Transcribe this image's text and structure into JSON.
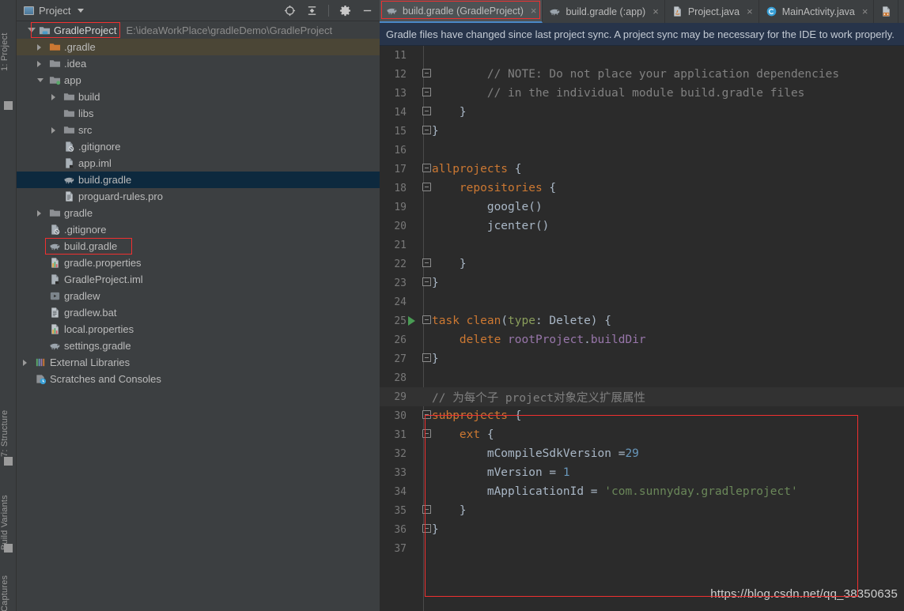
{
  "left_strip": {
    "top_label": "1: Project",
    "bottom_labels": [
      "7: Structure",
      "Build Variants",
      "Captures"
    ]
  },
  "project_panel": {
    "title": "Project",
    "toolbar_icons": [
      "locate-target-icon",
      "collapse-all-icon",
      "gear-icon",
      "minimize-icon"
    ],
    "root": {
      "name": "GradleProject",
      "path": "E:\\ideaWorkPlace\\gradleDemo\\GradleProject"
    },
    "tree": [
      {
        "label": ".gradle",
        "indent": 1,
        "arrow": "right",
        "icon": "folder-orange-icon",
        "state": "highlight"
      },
      {
        "label": ".idea",
        "indent": 1,
        "arrow": "right",
        "icon": "folder-icon",
        "state": ""
      },
      {
        "label": "app",
        "indent": 1,
        "arrow": "down",
        "icon": "module-folder-icon",
        "state": ""
      },
      {
        "label": "build",
        "indent": 2,
        "arrow": "right",
        "icon": "folder-icon",
        "state": ""
      },
      {
        "label": "libs",
        "indent": 2,
        "arrow": "none",
        "icon": "folder-icon",
        "state": ""
      },
      {
        "label": "src",
        "indent": 2,
        "arrow": "right",
        "icon": "folder-icon",
        "state": ""
      },
      {
        "label": ".gitignore",
        "indent": 2,
        "arrow": "none",
        "icon": "gitignore-file-icon",
        "state": ""
      },
      {
        "label": "app.iml",
        "indent": 2,
        "arrow": "none",
        "icon": "iml-file-icon",
        "state": ""
      },
      {
        "label": "build.gradle",
        "indent": 2,
        "arrow": "none",
        "icon": "gradle-file-icon",
        "state": "selected"
      },
      {
        "label": "proguard-rules.pro",
        "indent": 2,
        "arrow": "none",
        "icon": "text-file-icon",
        "state": ""
      },
      {
        "label": "gradle",
        "indent": 1,
        "arrow": "right",
        "icon": "folder-icon",
        "state": ""
      },
      {
        "label": ".gitignore",
        "indent": 1,
        "arrow": "none",
        "icon": "gitignore-file-icon",
        "state": ""
      },
      {
        "label": "build.gradle",
        "indent": 1,
        "arrow": "none",
        "icon": "gradle-file-icon",
        "state": "boxed"
      },
      {
        "label": "gradle.properties",
        "indent": 1,
        "arrow": "none",
        "icon": "properties-file-icon",
        "state": ""
      },
      {
        "label": "GradleProject.iml",
        "indent": 1,
        "arrow": "none",
        "icon": "iml-file-icon",
        "state": ""
      },
      {
        "label": "gradlew",
        "indent": 1,
        "arrow": "none",
        "icon": "script-file-icon",
        "state": ""
      },
      {
        "label": "gradlew.bat",
        "indent": 1,
        "arrow": "none",
        "icon": "text-file-icon",
        "state": ""
      },
      {
        "label": "local.properties",
        "indent": 1,
        "arrow": "none",
        "icon": "properties-file-icon",
        "state": ""
      },
      {
        "label": "settings.gradle",
        "indent": 1,
        "arrow": "none",
        "icon": "gradle-file-icon",
        "state": ""
      },
      {
        "label": "External Libraries",
        "indent": 0,
        "arrow": "right",
        "icon": "libraries-icon",
        "state": ""
      },
      {
        "label": "Scratches and Consoles",
        "indent": 0,
        "arrow": "none",
        "icon": "scratches-icon",
        "state": ""
      }
    ]
  },
  "editor": {
    "tabs": [
      {
        "label": "build.gradle (GradleProject)",
        "icon": "gradle-file-icon",
        "active": true,
        "closable": true,
        "boxed": true
      },
      {
        "label": "build.gradle (:app)",
        "icon": "gradle-file-icon",
        "active": false,
        "closable": true,
        "boxed": false
      },
      {
        "label": "Project.java",
        "icon": "java-file-icon",
        "active": false,
        "closable": true,
        "boxed": false
      },
      {
        "label": "MainActivity.java",
        "icon": "java-class-icon",
        "active": false,
        "closable": true,
        "boxed": false
      },
      {
        "label": "",
        "icon": "xml-file-icon",
        "active": false,
        "closable": false,
        "boxed": false
      }
    ],
    "notification": "Gradle files have changed since last project sync. A project sync may be necessary for the IDE to work properly.",
    "first_line_number": 11,
    "lines": [
      {
        "n": 11,
        "text": "",
        "fold": "",
        "caret": false,
        "run": false
      },
      {
        "n": 12,
        "text": "        // NOTE: Do not place your application dependencies",
        "fold": "start",
        "caret": false,
        "run": false
      },
      {
        "n": 13,
        "text": "        // in the individual module build.gradle files",
        "fold": "end",
        "caret": false,
        "run": false
      },
      {
        "n": 14,
        "text": "    }",
        "fold": "end",
        "caret": false,
        "run": false
      },
      {
        "n": 15,
        "text": "}",
        "fold": "end",
        "caret": false,
        "run": false
      },
      {
        "n": 16,
        "text": "",
        "fold": "",
        "caret": false,
        "run": false
      },
      {
        "n": 17,
        "text": "allprojects {",
        "fold": "start",
        "caret": false,
        "run": false
      },
      {
        "n": 18,
        "text": "    repositories {",
        "fold": "start",
        "caret": false,
        "run": false
      },
      {
        "n": 19,
        "text": "        google()",
        "fold": "",
        "caret": false,
        "run": false
      },
      {
        "n": 20,
        "text": "        jcenter()",
        "fold": "",
        "caret": false,
        "run": false
      },
      {
        "n": 21,
        "text": "",
        "fold": "",
        "caret": false,
        "run": false
      },
      {
        "n": 22,
        "text": "    }",
        "fold": "end",
        "caret": false,
        "run": false
      },
      {
        "n": 23,
        "text": "}",
        "fold": "end",
        "caret": false,
        "run": false
      },
      {
        "n": 24,
        "text": "",
        "fold": "",
        "caret": false,
        "run": false
      },
      {
        "n": 25,
        "text": "task clean(type: Delete) {",
        "fold": "start",
        "caret": false,
        "run": true
      },
      {
        "n": 26,
        "text": "    delete rootProject.buildDir",
        "fold": "",
        "caret": false,
        "run": false
      },
      {
        "n": 27,
        "text": "}",
        "fold": "end",
        "caret": false,
        "run": false
      },
      {
        "n": 28,
        "text": "",
        "fold": "",
        "caret": false,
        "run": false
      },
      {
        "n": 29,
        "text": "// 为每个子 project对象定义扩展属性",
        "fold": "",
        "caret": true,
        "run": false
      },
      {
        "n": 30,
        "text": "subprojects {",
        "fold": "start",
        "caret": false,
        "run": false
      },
      {
        "n": 31,
        "text": "    ext {",
        "fold": "start",
        "caret": false,
        "run": false
      },
      {
        "n": 32,
        "text": "        mCompileSdkVersion =29",
        "fold": "",
        "caret": false,
        "run": false
      },
      {
        "n": 33,
        "text": "        mVersion = 1",
        "fold": "",
        "caret": false,
        "run": false
      },
      {
        "n": 34,
        "text": "        mApplicationId = 'com.sunnyday.gradleproject'",
        "fold": "",
        "caret": false,
        "run": false
      },
      {
        "n": 35,
        "text": "    }",
        "fold": "end",
        "caret": false,
        "run": false
      },
      {
        "n": 36,
        "text": "}",
        "fold": "end",
        "caret": false,
        "run": false
      },
      {
        "n": 37,
        "text": "",
        "fold": "",
        "caret": false,
        "run": false
      }
    ],
    "watermark": "https://blog.csdn.net/qq_38350635"
  },
  "colors": {
    "panel_bg": "#3C3F41",
    "editor_bg": "#2B2B2B",
    "selection_bg": "#0D293E",
    "notification_bg": "#27344A",
    "accent_tab_underline": "#4A88C7",
    "annotation_red": "#F03030",
    "comment": "#808080",
    "keyword": "#CC7832",
    "number": "#6897BB",
    "string": "#6A8759",
    "field": "#9876AA",
    "default_text": "#A9B7C6"
  }
}
